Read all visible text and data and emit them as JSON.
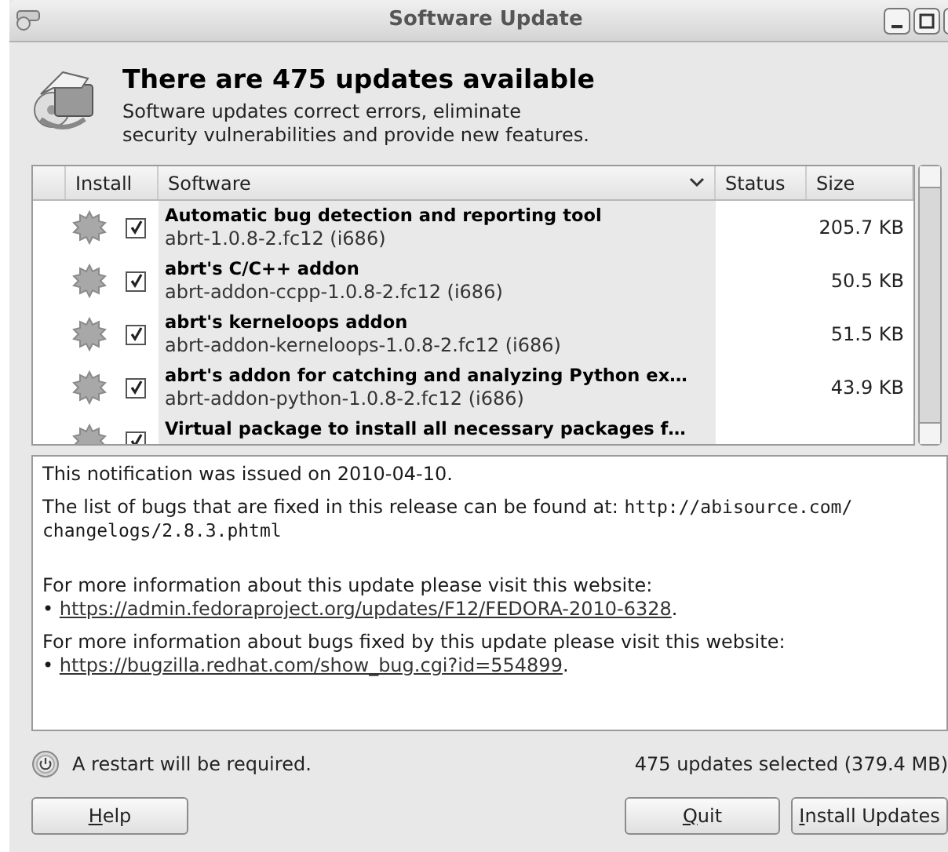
{
  "window": {
    "title": "Software Update"
  },
  "header": {
    "title": "There are 475 updates available",
    "description": "Software updates correct errors, eliminate\nsecurity vulnerabilities and provide new features."
  },
  "table": {
    "columns": [
      {
        "label": "Install",
        "sort_menu": false
      },
      {
        "label": "Software",
        "sort_menu": true
      },
      {
        "label": "Status",
        "sort_menu": false
      },
      {
        "label": "Size",
        "sort_menu": false
      }
    ],
    "rows": [
      {
        "name": "Automatic bug detection and reporting tool",
        "package": "abrt-1.0.8-2.fc12 (i686)",
        "size": "205.7 KB",
        "checked": true
      },
      {
        "name": "abrt's C/C++ addon",
        "package": "abrt-addon-ccpp-1.0.8-2.fc12 (i686)",
        "size": "50.5 KB",
        "checked": true
      },
      {
        "name": "abrt's kerneloops addon",
        "package": "abrt-addon-kerneloops-1.0.8-2.fc12 (i686)",
        "size": "51.5 KB",
        "checked": true
      },
      {
        "name": "abrt's addon for catching and analyzing Python ex…",
        "package": "abrt-addon-python-1.0.8-2.fc12 (i686)",
        "size": "43.9 KB",
        "checked": true
      },
      {
        "name": "Virtual package to install all necessary packages f…",
        "checked": true
      }
    ]
  },
  "details": [
    {
      "kind": "text",
      "text": "This notification was issued on 2010-04-10."
    },
    {
      "kind": "mixed",
      "text": "The list of bugs that are fixed in this release can be found at: ",
      "code": "http://abisource.com/\nchangelogs/2.8.3.phtml"
    },
    {
      "kind": "link",
      "text": "For more information about this update please visit this website:",
      "bullet": "•",
      "url": "https://admin.fedoraproject.org/updates/F12/FEDORA-2010-6328",
      "after": "."
    },
    {
      "kind": "link",
      "text": "For more information about bugs fixed by this update please visit this website:",
      "bullet": "•",
      "url": "https://bugzilla.redhat.com/show_bug.cgi?id=554899",
      "after": "."
    }
  ],
  "status": {
    "restart": "A restart will be required.",
    "summary": "475 updates selected (379.4 MB)"
  },
  "buttons": [
    {
      "label": "Help"
    },
    {
      "label": "Quit"
    },
    {
      "label": "Install Updates"
    }
  ]
}
